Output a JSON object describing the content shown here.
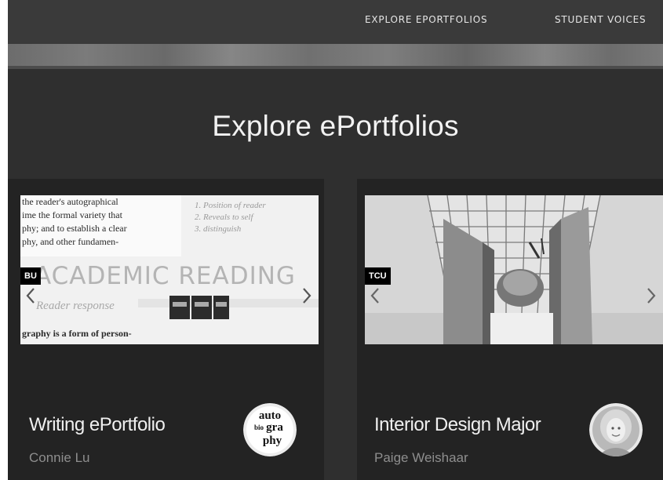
{
  "nav": {
    "items": [
      {
        "label": "EXPLORE EPORTFOLIOS"
      },
      {
        "label": "STUDENT VOICES"
      }
    ]
  },
  "main": {
    "title": "Explore ePortfolios",
    "cards": [
      {
        "badge": "BU",
        "title": "Writing ePortfolio",
        "author": "Connie Lu",
        "image_lines": [
          "the reader's autographical",
          "ime the formal variety that",
          "phy; and to establish a clear",
          "phy, and other fundamen-",
          "graphy is a form of person-"
        ],
        "image_heading": "ACADEMIC READING",
        "image_subheading": "Reader response",
        "image_notes": [
          "1. Position of reader",
          "2. Reveals to self",
          "3. distinguish"
        ],
        "avatar_text": [
          "auto",
          "bio",
          "gra",
          "phy"
        ]
      },
      {
        "badge": "TCU",
        "title": "Interior Design Major",
        "author": "Paige Weishaar"
      }
    ]
  },
  "colors": {
    "topbar": "#3a3a3a",
    "section_bg": "#2f2f2f",
    "card_bg": "#232323",
    "badge_bg": "#000000"
  },
  "icons": [
    "chevron-left-icon",
    "chevron-right-icon"
  ]
}
